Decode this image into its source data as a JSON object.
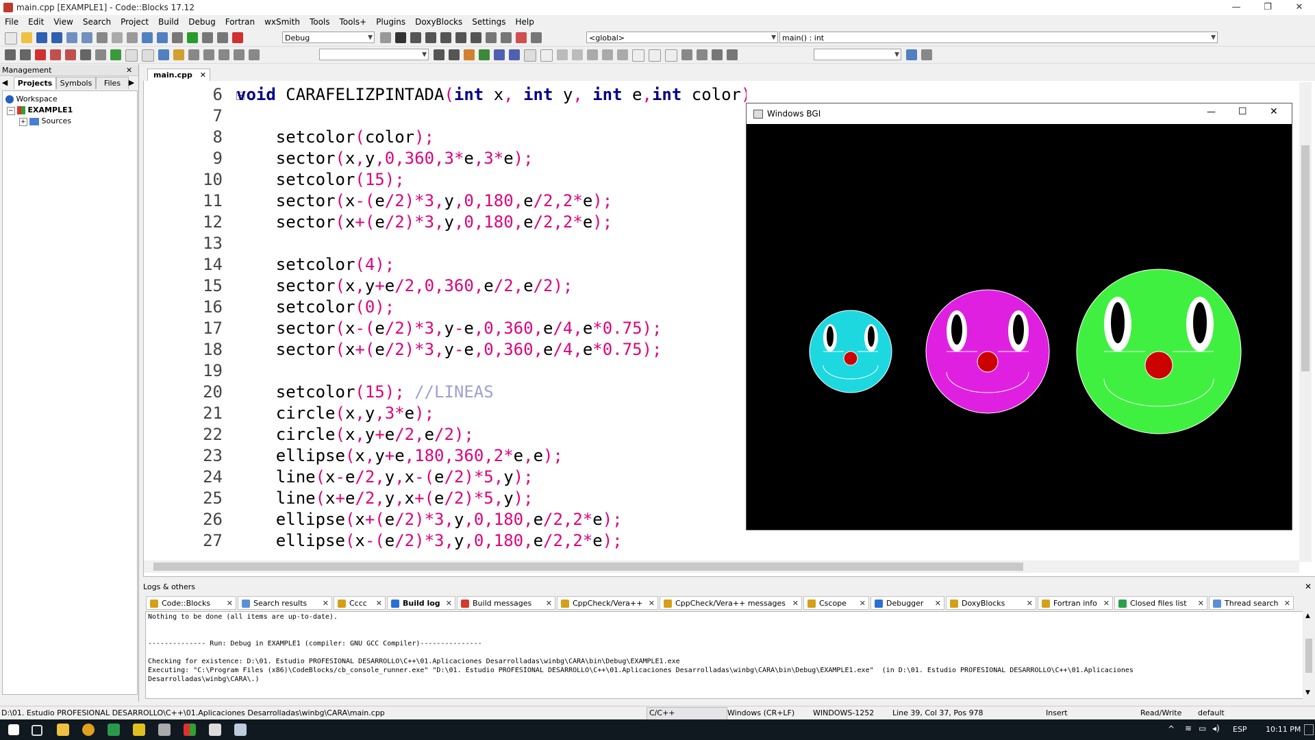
{
  "window": {
    "title": "main.cpp [EXAMPLE1] - Code::Blocks 17.12",
    "minimize": "—",
    "restore": "❐",
    "close": "✕"
  },
  "menu": [
    "File",
    "Edit",
    "View",
    "Search",
    "Project",
    "Build",
    "Debug",
    "Fortran",
    "wxSmith",
    "Tools",
    "Tools+",
    "Plugins",
    "DoxyBlocks",
    "Settings",
    "Help"
  ],
  "toolbar": {
    "build_target": "Debug",
    "scope": "<global>",
    "function": "main() : int"
  },
  "management": {
    "title": "Management",
    "tabs": [
      "Projects",
      "Symbols",
      "Files"
    ],
    "workspace": "Workspace",
    "project": "EXAMPLE1",
    "folder": "Sources"
  },
  "editor": {
    "tab": "main.cpp",
    "lines": [
      {
        "no": "6",
        "html": "<span class='kw'>void</span> CARAFELIZPINTADA<span class='p'>(</span><span class='kw'>int</span> x<span class='p'>,</span> <span class='kw'>int</span> y<span class='p'>,</span> <span class='kw'>int</span> e<span class='p'>,</span><span class='kw'>int</span> color<span class='p'>){</span>"
      },
      {
        "no": "7",
        "html": ""
      },
      {
        "no": "8",
        "html": "    setcolor<span class='p'>(</span>color<span class='p'>);</span>"
      },
      {
        "no": "9",
        "html": "    sector<span class='p'>(</span>x<span class='p'>,</span>y<span class='p'>,</span><span class='n'>0</span><span class='p'>,</span><span class='n'>360</span><span class='p'>,</span><span class='n'>3</span><span class='p'>*</span>e<span class='p'>,</span><span class='n'>3</span><span class='p'>*</span>e<span class='p'>);</span>"
      },
      {
        "no": "10",
        "html": "    setcolor<span class='p'>(</span><span class='n'>15</span><span class='p'>);</span>"
      },
      {
        "no": "11",
        "html": "    sector<span class='p'>(</span>x<span class='p'>-(</span>e<span class='p'>/</span><span class='n'>2</span><span class='p'>)*</span><span class='n'>3</span><span class='p'>,</span>y<span class='p'>,</span><span class='n'>0</span><span class='p'>,</span><span class='n'>180</span><span class='p'>,</span>e<span class='p'>/</span><span class='n'>2</span><span class='p'>,</span><span class='n'>2</span><span class='p'>*</span>e<span class='p'>);</span>"
      },
      {
        "no": "12",
        "html": "    sector<span class='p'>(</span>x<span class='p'>+(</span>e<span class='p'>/</span><span class='n'>2</span><span class='p'>)*</span><span class='n'>3</span><span class='p'>,</span>y<span class='p'>,</span><span class='n'>0</span><span class='p'>,</span><span class='n'>180</span><span class='p'>,</span>e<span class='p'>/</span><span class='n'>2</span><span class='p'>,</span><span class='n'>2</span><span class='p'>*</span>e<span class='p'>);</span>"
      },
      {
        "no": "13",
        "html": ""
      },
      {
        "no": "14",
        "html": "    setcolor<span class='p'>(</span><span class='n'>4</span><span class='p'>);</span>"
      },
      {
        "no": "15",
        "html": "    sector<span class='p'>(</span>x<span class='p'>,</span>y<span class='p'>+</span>e<span class='p'>/</span><span class='n'>2</span><span class='p'>,</span><span class='n'>0</span><span class='p'>,</span><span class='n'>360</span><span class='p'>,</span>e<span class='p'>/</span><span class='n'>2</span><span class='p'>,</span>e<span class='p'>/</span><span class='n'>2</span><span class='p'>);</span>"
      },
      {
        "no": "16",
        "html": "    setcolor<span class='p'>(</span><span class='n'>0</span><span class='p'>);</span>"
      },
      {
        "no": "17",
        "html": "    sector<span class='p'>(</span>x<span class='p'>-(</span>e<span class='p'>/</span><span class='n'>2</span><span class='p'>)*</span><span class='n'>3</span><span class='p'>,</span>y<span class='p'>-</span>e<span class='p'>,</span><span class='n'>0</span><span class='p'>,</span><span class='n'>360</span><span class='p'>,</span>e<span class='p'>/</span><span class='n'>4</span><span class='p'>,</span>e<span class='p'>*</span><span class='n'>0.75</span><span class='p'>);</span>"
      },
      {
        "no": "18",
        "html": "    sector<span class='p'>(</span>x<span class='p'>+(</span>e<span class='p'>/</span><span class='n'>2</span><span class='p'>)*</span><span class='n'>3</span><span class='p'>,</span>y<span class='p'>-</span>e<span class='p'>,</span><span class='n'>0</span><span class='p'>,</span><span class='n'>360</span><span class='p'>,</span>e<span class='p'>/</span><span class='n'>4</span><span class='p'>,</span>e<span class='p'>*</span><span class='n'>0.75</span><span class='p'>);</span>"
      },
      {
        "no": "19",
        "html": ""
      },
      {
        "no": "20",
        "html": "    setcolor<span class='p'>(</span><span class='n'>15</span><span class='p'>);</span> <span class='cm'>//LINEAS</span>"
      },
      {
        "no": "21",
        "html": "    circle<span class='p'>(</span>x<span class='p'>,</span>y<span class='p'>,</span><span class='n'>3</span><span class='p'>*</span>e<span class='p'>);</span>"
      },
      {
        "no": "22",
        "html": "    circle<span class='p'>(</span>x<span class='p'>,</span>y<span class='p'>+</span>e<span class='p'>/</span><span class='n'>2</span><span class='p'>,</span>e<span class='p'>/</span><span class='n'>2</span><span class='p'>);</span>"
      },
      {
        "no": "23",
        "html": "    ellipse<span class='p'>(</span>x<span class='p'>,</span>y<span class='p'>+</span>e<span class='p'>,</span><span class='n'>180</span><span class='p'>,</span><span class='n'>360</span><span class='p'>,</span><span class='n'>2</span><span class='p'>*</span>e<span class='p'>,</span>e<span class='p'>);</span>"
      },
      {
        "no": "24",
        "html": "    line<span class='p'>(</span>x<span class='p'>-</span>e<span class='p'>/</span><span class='n'>2</span><span class='p'>,</span>y<span class='p'>,</span>x<span class='p'>-(</span>e<span class='p'>/</span><span class='n'>2</span><span class='p'>)*</span><span class='n'>5</span><span class='p'>,</span>y<span class='p'>);</span>"
      },
      {
        "no": "25",
        "html": "    line<span class='p'>(</span>x<span class='p'>+</span>e<span class='p'>/</span><span class='n'>2</span><span class='p'>,</span>y<span class='p'>,</span>x<span class='p'>+(</span>e<span class='p'>/</span><span class='n'>2</span><span class='p'>)*</span><span class='n'>5</span><span class='p'>,</span>y<span class='p'>);</span>"
      },
      {
        "no": "26",
        "html": "    ellipse<span class='p'>(</span>x<span class='p'>+(</span>e<span class='p'>/</span><span class='n'>2</span><span class='p'>)*</span><span class='n'>3</span><span class='p'>,</span>y<span class='p'>,</span><span class='n'>0</span><span class='p'>,</span><span class='n'>180</span><span class='p'>,</span>e<span class='p'>/</span><span class='n'>2</span><span class='p'>,</span><span class='n'>2</span><span class='p'>*</span>e<span class='p'>);</span>"
      },
      {
        "no": "27",
        "html": "    ellipse<span class='p'>(</span>x<span class='p'>-(</span>e<span class='p'>/</span><span class='n'>2</span><span class='p'>)*</span><span class='n'>3</span><span class='p'>,</span>y<span class='p'>,</span><span class='n'>0</span><span class='p'>,</span><span class='n'>180</span><span class='p'>,</span>e<span class='p'>/</span><span class='n'>2</span><span class='p'>,</span><span class='n'>2</span><span class='p'>*</span>e<span class='p'>);</span>"
      }
    ]
  },
  "bgi": {
    "title": "Windows BGI",
    "faces": [
      {
        "color": "#1ed8e0"
      },
      {
        "color": "#e020e0"
      },
      {
        "color": "#40f040"
      }
    ]
  },
  "logs": {
    "title": "Logs & others",
    "tabs": [
      {
        "label": "Code::Blocks",
        "color": "#d4a017"
      },
      {
        "label": "Search results",
        "color": "#5a8fd6"
      },
      {
        "label": "Cccc",
        "color": "#d4a017"
      },
      {
        "label": "Build log",
        "color": "#2a6fd6",
        "active": true
      },
      {
        "label": "Build messages",
        "color": "#d63a2a"
      },
      {
        "label": "CppCheck/Vera++",
        "color": "#d4a017"
      },
      {
        "label": "CppCheck/Vera++ messages",
        "color": "#d4a017"
      },
      {
        "label": "Cscope",
        "color": "#d4a017"
      },
      {
        "label": "Debugger",
        "color": "#2a6fd6"
      },
      {
        "label": "DoxyBlocks",
        "color": "#d4a017"
      },
      {
        "label": "Fortran info",
        "color": "#d4a017"
      },
      {
        "label": "Closed files list",
        "color": "#2aa04a"
      },
      {
        "label": "Thread search",
        "color": "#5a8fd6"
      }
    ],
    "lines": [
      "Nothing to be done (all items are up-to-date).",
      "",
      "",
      "-------------- Run: Debug in EXAMPLE1 (compiler: GNU GCC Compiler)---------------",
      "",
      "Checking for existence: D:\\01. Estudio PROFESIONAL DESARROLLO\\C++\\01.Aplicaciones Desarrolladas\\winbg\\CARA\\bin\\Debug\\EXAMPLE1.exe",
      "Executing: \"C:\\Program Files (x86)\\CodeBlocks/cb_console_runner.exe\" \"D:\\01. Estudio PROFESIONAL DESARROLLO\\C++\\01.Aplicaciones Desarrolladas\\winbg\\CARA\\bin\\Debug\\EXAMPLE1.exe\"  (in D:\\01. Estudio PROFESIONAL DESARROLLO\\C++\\01.Aplicaciones",
      "Desarrolladas\\winbg\\CARA\\.)"
    ]
  },
  "status": {
    "path": "D:\\01. Estudio PROFESIONAL DESARROLLO\\C++\\01.Aplicaciones Desarrolladas\\winbg\\CARA\\main.cpp",
    "lang": "C/C++",
    "eol": "Windows (CR+LF)",
    "encoding": "WINDOWS-1252",
    "position": "Line 39, Col 37, Pos 978",
    "mode": "Insert",
    "access": "Read/Write",
    "profile": "default"
  },
  "taskbar": {
    "lang": "ESP",
    "time": "10:11 PM"
  }
}
